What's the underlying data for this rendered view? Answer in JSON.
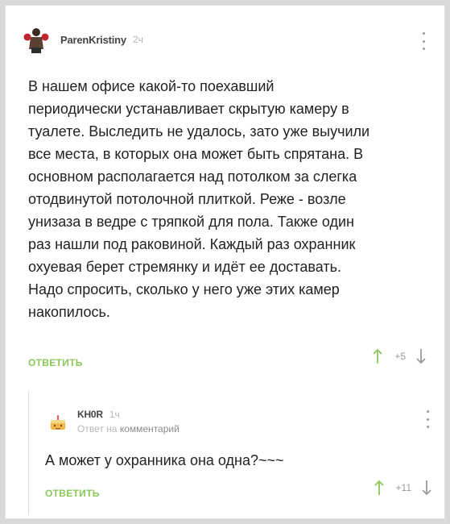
{
  "comment": {
    "username": "ParenKristiny",
    "time": "2ч",
    "text": "В нашем офисе какой-то поехавший\nпериодически устанавливает скрытую камеру в\nтуалете. Выследить не удалось, зато уже выучили\nвсе места, в которых она может быть спрятана. В\nосновном располагается над потолком за слегка\nотодвинутой потолочной плиткой. Реже - возле\nунизаза в ведре с тряпкой для пола. Также один\nраз нашли под раковиной. Каждый раз охранник\nохуевая берет стремянку и идёт ее доставать.\nНадо спросить, сколько у него уже этих камер\nнакопилось.",
    "reply_label": "ОТВЕТИТЬ",
    "rating": "+5"
  },
  "reply": {
    "username": "KH0R",
    "time": "1ч",
    "reply_to_prefix": "Ответ на",
    "reply_to_target": "комментарий",
    "text": "А может у охранника она одна?~~~",
    "reply_label": "ОТВЕТИТЬ",
    "rating": "+11"
  },
  "colors": {
    "accent": "#8ac858",
    "muted": "#b6b6b6"
  },
  "icons": {
    "avatar1": "boxer-avatar",
    "avatar2": "cake-avatar",
    "upvote": "arrow-up-icon",
    "downvote": "arrow-down-icon",
    "more": "more-vertical-icon"
  }
}
